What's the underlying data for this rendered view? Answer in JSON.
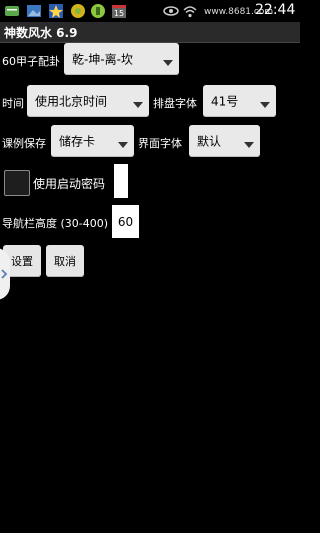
{
  "status_bar": {
    "time": "22:44",
    "watermark": "www.8681.com",
    "icons": [
      "message-icon",
      "gallery-icon",
      "star-icon",
      "app-icon",
      "app-icon",
      "calendar-icon",
      "eye-icon",
      "wifi-icon",
      "signal-icon",
      "battery-icon"
    ]
  },
  "app": {
    "title": "神数风水 6.9"
  },
  "form": {
    "jiazi": {
      "label": "60甲子配卦",
      "value": "乾-坤-离-坎"
    },
    "time": {
      "label": "时间",
      "value": "使用北京时间"
    },
    "chart_font": {
      "label": "排盘字体",
      "value": "41号"
    },
    "lesson_save": {
      "label": "课例保存",
      "value": "储存卡"
    },
    "ui_font": {
      "label": "界面字体",
      "value": "默认"
    },
    "password": {
      "label": "使用启动密码",
      "value": ""
    },
    "nav_height": {
      "label": "导航栏高度 (30-400)",
      "value": "60"
    }
  },
  "buttons": {
    "set": "设置",
    "cancel": "取消"
  }
}
